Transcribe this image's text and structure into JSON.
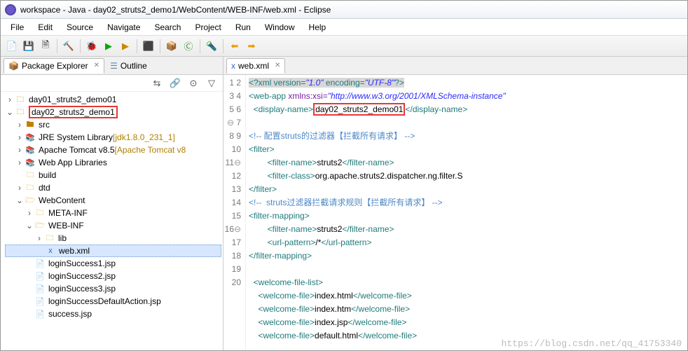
{
  "window": {
    "title": "workspace - Java - day02_struts2_demo1/WebContent/WEB-INF/web.xml - Eclipse"
  },
  "menu": [
    "File",
    "Edit",
    "Source",
    "Navigate",
    "Search",
    "Project",
    "Run",
    "Window",
    "Help"
  ],
  "leftTabs": {
    "explorer": "Package Explorer",
    "outline": "Outline"
  },
  "tree": {
    "p1": "day01_struts2_demo01",
    "p2": "day02_struts2_demo1",
    "src": "src",
    "jre": "JRE System Library",
    "jreDeco": "[jdk1.8.0_231_1]",
    "tom": "Apache Tomcat v8.5",
    "tomDeco": "[Apache Tomcat v8",
    "wal": "Web App Libraries",
    "build": "build",
    "dtd": "dtd",
    "wc": "WebContent",
    "meta": "META-INF",
    "webinf": "WEB-INF",
    "lib": "lib",
    "webxml": "web.xml",
    "f1": "loginSuccess1.jsp",
    "f2": "loginSuccess2.jsp",
    "f3": "loginSuccess3.jsp",
    "f4": "loginSuccessDefaultAction.jsp",
    "f5": "success.jsp"
  },
  "editorTab": "web.xml",
  "watermark": "https://blog.csdn.net/qq_41753340",
  "code": {
    "l1a": "<?xml version=",
    "l1b": "\"1.0\"",
    "l1c": " encoding=",
    "l1d": "\"UTF-8\"",
    "l1e": "?>",
    "l2a": "<web-app",
    "l2b": " xmlns:xsi=",
    "l2c": "\"http://www.w3.org/2001/XMLSchema-instance\"",
    "l3a": "  <display-name>",
    "l3b": "day02_struts2_demo01",
    "l3c": "</display-name>",
    "l5": "<!-- 配置struts的过滤器【拦截所有请求】 -->",
    "l6a": "<filter>",
    "l7a": "        <filter-name>",
    "l7b": "struts2",
    "l7c": "</filter-name>",
    "l8a": "        <filter-class>",
    "l8b": "org.apache.struts2.dispatcher.ng.filter.S",
    "l9": "</filter>",
    "l10": "<!--  struts过滤器拦截请求规则【拦截所有请求】 -->",
    "l11": "<filter-mapping>",
    "l12a": "        <filter-name>",
    "l12b": "struts2",
    "l12c": "</filter-name>",
    "l13a": "        <url-pattern>",
    "l13b": "/*",
    "l13c": "</url-pattern>",
    "l14": "</filter-mapping>",
    "l16": "  <welcome-file-list>",
    "l17a": "    <welcome-file>",
    "l17b": "index.html",
    "l17c": "</welcome-file>",
    "l18a": "    <welcome-file>",
    "l18b": "index.htm",
    "l18c": "</welcome-file>",
    "l19a": "    <welcome-file>",
    "l19b": "index.jsp",
    "l19c": "</welcome-file>",
    "l20a": "    <welcome-file>",
    "l20b": "default.html",
    "l20c": "</welcome-file>"
  }
}
